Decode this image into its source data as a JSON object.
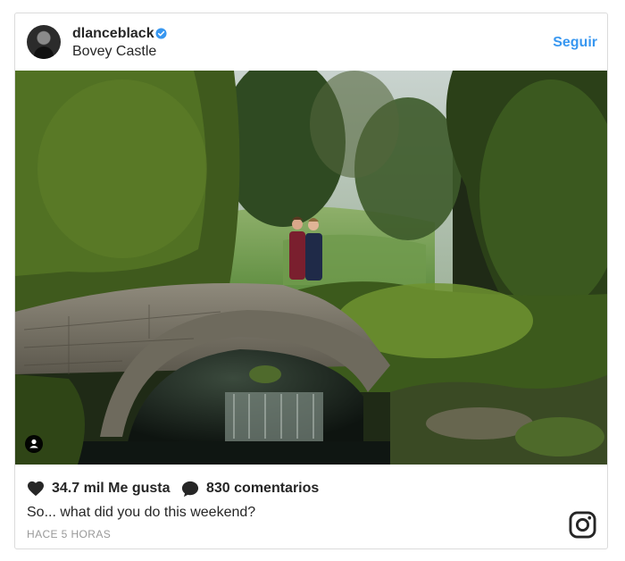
{
  "post": {
    "username": "dlanceblack",
    "verified": true,
    "location": "Bovey Castle",
    "follow_label": "Seguir",
    "likes_text": "34.7 mil Me gusta",
    "comments_text": "830 comentarios",
    "caption": "So... what did you do this weekend?",
    "timestamp": "HACE 5 HORAS"
  },
  "icons": {
    "like": "heart-icon",
    "comment": "speech-bubble-icon",
    "verified": "verified-badge-icon",
    "user_tag": "user-tag-icon",
    "brand": "instagram-logo-icon"
  },
  "colors": {
    "link_blue": "#3897f0",
    "text": "#262626",
    "muted": "#999999",
    "border": "#dbdbdb"
  }
}
